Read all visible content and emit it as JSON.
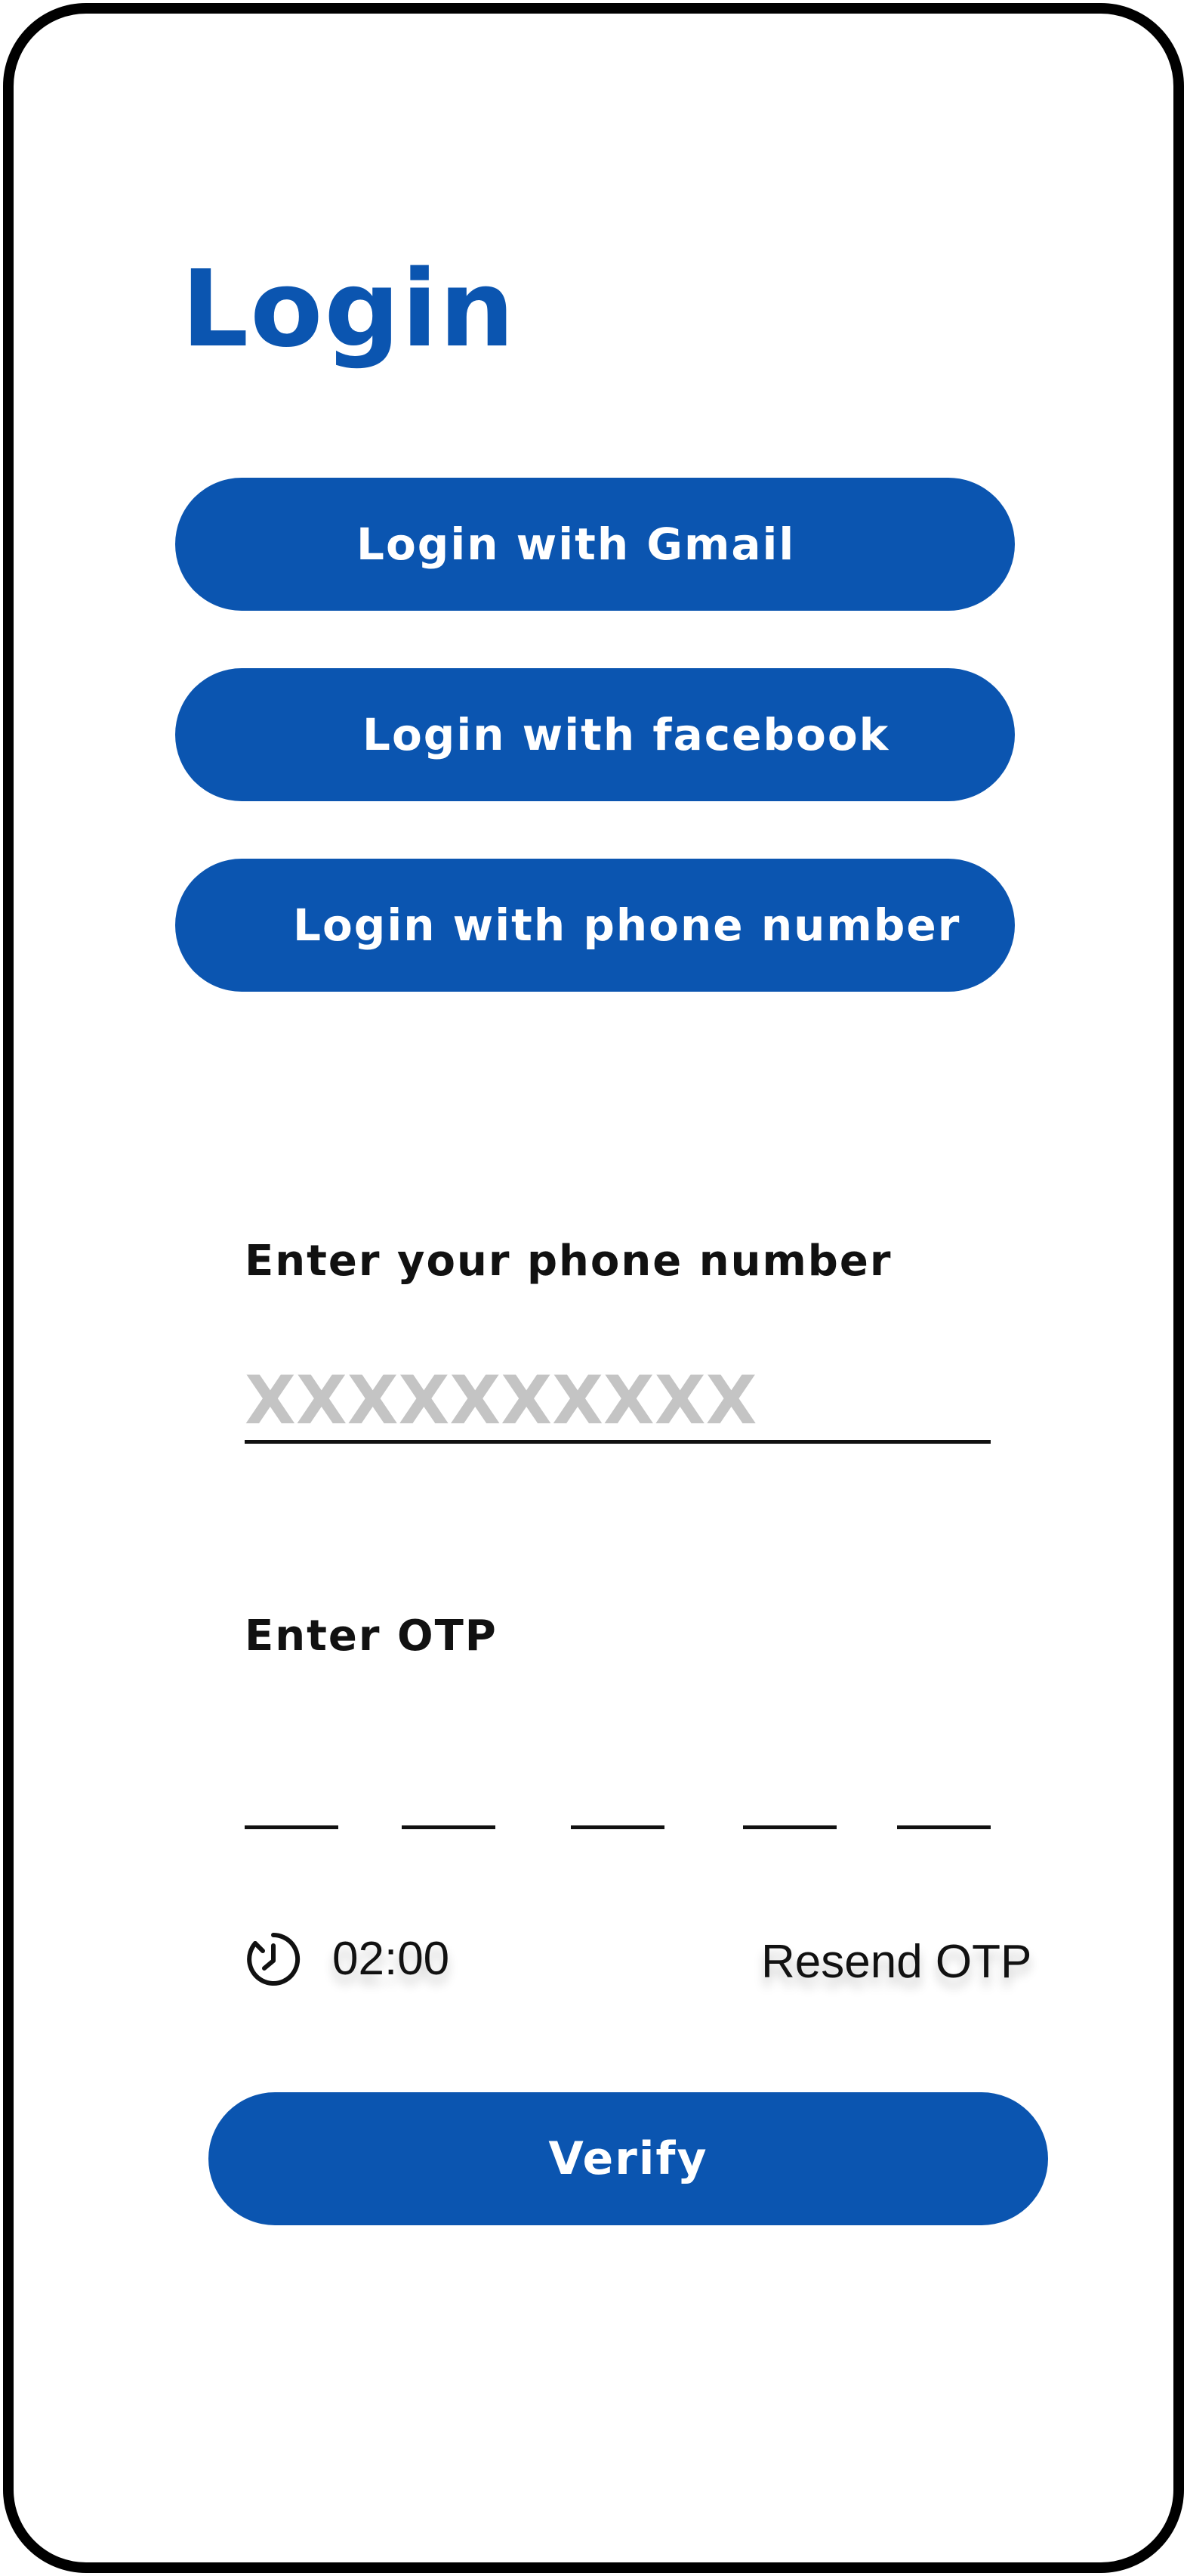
{
  "screen": {
    "title": "Login"
  },
  "social_login": {
    "gmail_label": "Login with Gmail",
    "facebook_label": "Login with facebook",
    "phone_label": "Login with phone number"
  },
  "phone_form": {
    "label": "Enter your phone number",
    "value": "",
    "placeholder": "XXXXXXXXXX"
  },
  "otp_form": {
    "label": "Enter OTP",
    "digits": [
      "",
      "",
      "",
      "",
      ""
    ],
    "timer": "02:00",
    "timer_icon": "timer-icon",
    "resend_label": "Resend OTP"
  },
  "actions": {
    "verify_label": "Verify"
  },
  "colors": {
    "primary": "#0b55b0",
    "text": "#111111",
    "placeholder": "#c4c4c4",
    "background": "#ffffff",
    "frame": "#000000"
  }
}
